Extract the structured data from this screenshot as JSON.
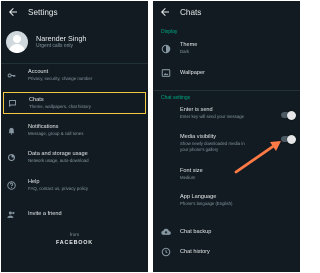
{
  "left": {
    "title": "Settings",
    "profile": {
      "name": "Narender Singh",
      "status": "Urgent calls only"
    },
    "items": [
      {
        "label": "Account",
        "sub": "Privacy, security, change number"
      },
      {
        "label": "Chats",
        "sub": "Theme, wallpapers, chat history"
      },
      {
        "label": "Notifications",
        "sub": "Message, group & call tones"
      },
      {
        "label": "Data and storage usage",
        "sub": "Network usage, auto-download"
      },
      {
        "label": "Help",
        "sub": "FAQ, contact us, privacy policy"
      },
      {
        "label": "Invite a friend",
        "sub": ""
      }
    ],
    "from": "from",
    "brand": "FACEBOOK"
  },
  "right": {
    "title": "Chats",
    "display_header": "Display",
    "theme": {
      "label": "Theme",
      "sub": "Dark"
    },
    "wallpaper": {
      "label": "Wallpaper"
    },
    "settings_header": "Chat settings",
    "enter_send": {
      "label": "Enter is send",
      "sub": "Enter key will send your message"
    },
    "media": {
      "label": "Media visibility",
      "sub1": "Show newly downloaded media in",
      "sub2": "your phone's gallery"
    },
    "font": {
      "label": "Font size",
      "sub": "Medium"
    },
    "language": {
      "label": "App Language",
      "sub": "Phone's language (English)"
    },
    "backup": {
      "label": "Chat backup"
    },
    "history": {
      "label": "Chat history"
    }
  },
  "colors": {
    "background": "#111b21",
    "accent": "#00a884",
    "highlight": "#f2c744",
    "arrow": "#ff7a45"
  }
}
